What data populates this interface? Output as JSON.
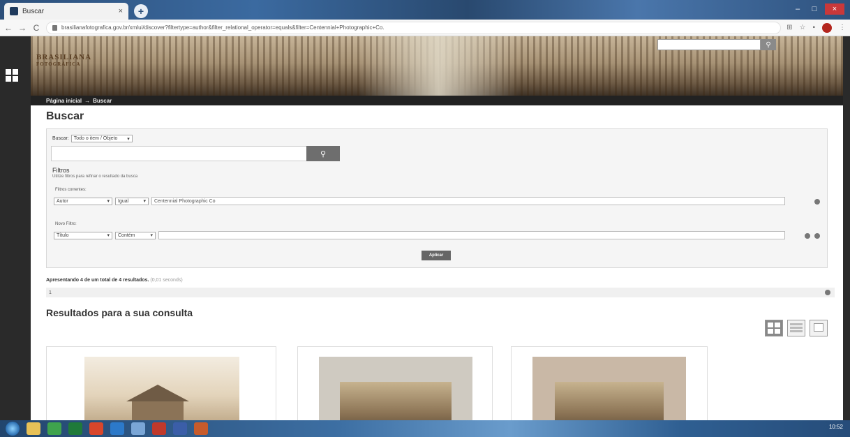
{
  "browser": {
    "tab_title": "Buscar",
    "url": "brasilianafotografica.gov.br/xmlui/discover?filtertype=author&filter_relational_operator=equals&filter=Centennial+Photographic+Co."
  },
  "site": {
    "logo_text": "BRASILIANA",
    "logo_subtext": "FOTOGRÁFICA",
    "breadcrumb_home": "Página inicial",
    "breadcrumb_sep": "→",
    "breadcrumb_current": "Buscar"
  },
  "search": {
    "page_title": "Buscar",
    "scope_label": "Buscar:",
    "scope_value": "Todo o item / Objeto",
    "query_value": "",
    "filters_title": "Filtros",
    "filters_desc": "Utilize filtros para refinar o resultado da busca",
    "current_filters_label": "Filtros correntes:",
    "current_filter": {
      "field": "Autor",
      "operator": "Igual",
      "value": "Centennial Photographic Co"
    },
    "new_filter_label": "Novo Filtro:",
    "new_filter": {
      "field": "Título",
      "operator": "Contém",
      "value": ""
    },
    "apply_label": "Aplicar"
  },
  "results": {
    "summary": "Apresentando 4 de um total de 4 resultados.",
    "timing": "(0,01 seconds)",
    "page_number": "1",
    "title": "Resultados para a sua consulta"
  },
  "taskbar": {
    "clock": "10:52"
  }
}
